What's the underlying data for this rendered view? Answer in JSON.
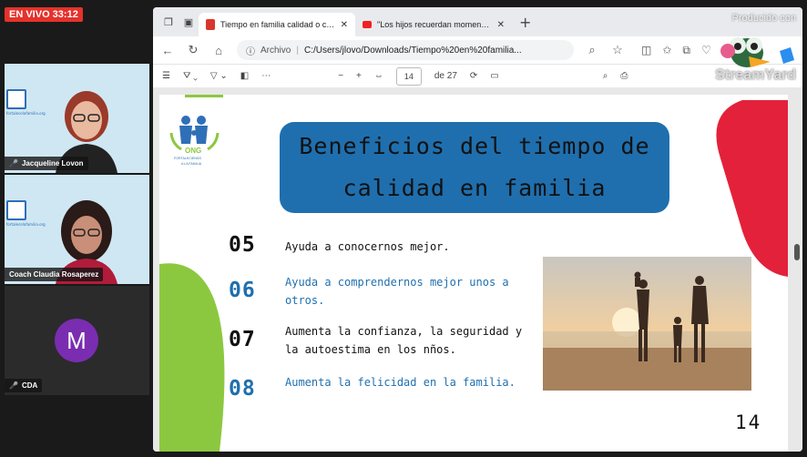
{
  "stream": {
    "live_badge": "EN VIVO 33:12",
    "watermark_top": "Producido con",
    "watermark_brand": "StreamYard"
  },
  "participants": [
    {
      "name": "Jacqueline Lovon"
    },
    {
      "name": "Coach Claudia Rosaperez"
    },
    {
      "name": "CDA",
      "initial": "M",
      "avatar_color": "#7a2db0"
    }
  ],
  "browser": {
    "tabs": [
      {
        "label": "Tiempo en familia calidad o canti",
        "active": true,
        "icon": "pdf-icon"
      },
      {
        "label": "\"Los hijos recuerdan momentos, n",
        "active": false,
        "icon": "youtube-icon"
      }
    ],
    "address": {
      "scheme": "Archivo",
      "path": "C:/Users/jlovo/Downloads/Tiempo%20en%20familia..."
    },
    "pdf": {
      "page": "14",
      "of": "de 27",
      "zoom_minus": "−",
      "zoom_plus": "+"
    }
  },
  "slide": {
    "logo_text": "ONG",
    "logo_sub": "FORTALECIENDO A LA FAMILIA",
    "title": "Beneficios del tiempo de calidad en familia",
    "items": [
      {
        "num": "05",
        "text": "Ayuda a conocernos mejor."
      },
      {
        "num": "06",
        "text": "Ayuda a comprendernos mejor unos a otros."
      },
      {
        "num": "07",
        "text": "Aumenta la confianza, la seguridad y la autoestima en los nños."
      },
      {
        "num": "08",
        "text": "Aumenta la felicidad en la familia."
      }
    ],
    "page_number": "14"
  },
  "colors": {
    "accent_blue": "#1f6fae",
    "live_red": "#e4322b",
    "shape_red": "#e4213a",
    "shape_green": "#8cc83f"
  }
}
